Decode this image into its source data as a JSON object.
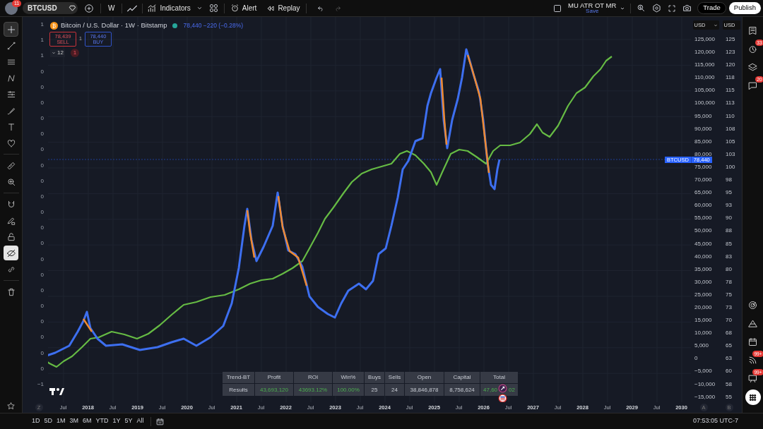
{
  "top_bar": {
    "avatar_badge": "11",
    "symbol": "BTCUSD",
    "interval": "W",
    "indicators": "Indicators",
    "alert": "Alert",
    "replay": "Replay",
    "history": [
      {
        "kind": "undo",
        "disabled": false
      },
      {
        "kind": "redo",
        "disabled": true
      }
    ],
    "layout_name": "MU ATR OT MR",
    "save_label": "Save",
    "trade": "Trade",
    "publish": "Publish"
  },
  "left_tool_groups": [
    {
      "tools": [
        {
          "kind": "crosshair",
          "selected": true,
          "on": false
        },
        {
          "kind": "line",
          "selected": false,
          "on": false
        },
        {
          "kind": "channel",
          "selected": false,
          "on": false
        },
        {
          "kind": "pattern",
          "selected": false,
          "on": false
        },
        {
          "kind": "fib",
          "selected": false,
          "on": false
        },
        {
          "kind": "brush",
          "selected": false,
          "on": false
        },
        {
          "kind": "text",
          "selected": false,
          "on": false
        },
        {
          "kind": "heart",
          "selected": false,
          "on": false
        }
      ]
    },
    {
      "tools": [
        {
          "kind": "ruler",
          "selected": false,
          "on": false
        },
        {
          "kind": "zoom",
          "selected": false,
          "on": false
        }
      ]
    },
    {
      "tools": [
        {
          "kind": "magnet",
          "selected": false,
          "on": false
        },
        {
          "kind": "pencil",
          "selected": false,
          "on": false
        },
        {
          "kind": "lock",
          "selected": false,
          "on": false
        },
        {
          "kind": "hide",
          "selected": false,
          "on": true
        },
        {
          "kind": "link",
          "selected": false,
          "on": false
        }
      ]
    },
    {
      "tools": [
        {
          "kind": "trash",
          "selected": false,
          "on": false
        }
      ]
    }
  ],
  "legend": {
    "coin_glyph": "₿",
    "title": "Bitcoin / U.S. Dollar · 1W · Bitstamp",
    "quote": "78,440 −220 (−0.28%)",
    "sell": {
      "price": "78,439",
      "label": "SELL"
    },
    "quantity": "1",
    "buy": {
      "price": "78,440",
      "label": "BUY"
    },
    "collapsed_count": "12",
    "alert_count": "1"
  },
  "left_axis": [
    "1",
    "1",
    "1",
    "0",
    "0",
    "0",
    "0",
    "0",
    "0",
    "0",
    "0",
    "0",
    "0",
    "0",
    "0",
    "0",
    "0",
    "0",
    "0",
    "0",
    "0",
    "0",
    "0",
    "−1"
  ],
  "price_axis": {
    "currency": "USD",
    "labels": [
      "125,000",
      "120,000",
      "115,000",
      "110,000",
      "105,000",
      "100,000",
      "95,000",
      "90,000",
      "85,000",
      "80,000",
      "75,000",
      "70,000",
      "65,000",
      "60,000",
      "55,000",
      "50,000",
      "45,000",
      "40,000",
      "35,000",
      "30,000",
      "25,000",
      "20,000",
      "15,000",
      "10,000",
      "5,000",
      "0",
      "−5,000",
      "−10,000",
      "−15,000"
    ]
  },
  "second_axis": {
    "currency": "USD",
    "labels": [
      "125",
      "123",
      "120",
      "118",
      "115",
      "113",
      "110",
      "108",
      "105",
      "103",
      "100",
      "98",
      "95",
      "93",
      "90",
      "88",
      "85",
      "83",
      "80",
      "78",
      "75",
      "73",
      "70",
      "68",
      "65",
      "63",
      "60",
      "58",
      "55"
    ]
  },
  "price_tag": {
    "symbol": "BTCUSD",
    "price": "78,440"
  },
  "time_axis": {
    "start": "Z",
    "labels": [
      "Jul",
      "2018",
      "Jul",
      "2019",
      "Jul",
      "2020",
      "Jul",
      "2021",
      "Jul",
      "2022",
      "Jul",
      "2023",
      "Jul",
      "2024",
      "Jul",
      "2025",
      "Jul",
      "2026",
      "Jul",
      "2027",
      "Jul",
      "2028",
      "Jul",
      "2029",
      "Jul",
      "2030"
    ],
    "end": [
      "A",
      "B"
    ]
  },
  "results_table": {
    "columns": [
      "Trend-BT",
      "Profit",
      "ROI",
      "Win%",
      "Buys",
      "Sells",
      "Open",
      "Capital",
      "Total"
    ],
    "rows": [
      [
        {
          "text": "Results",
          "positive": false
        },
        {
          "text": "43,693,120",
          "positive": true
        },
        {
          "text": "43693.12%",
          "positive": true
        },
        {
          "text": "100.00%",
          "positive": true
        },
        {
          "text": "25",
          "positive": false
        },
        {
          "text": "24",
          "positive": false
        },
        {
          "text": "38,846,878",
          "positive": false
        },
        {
          "text": "8,758,624",
          "positive": false
        },
        {
          "text": "47,60",
          "text_after": "02",
          "positive": true
        }
      ]
    ]
  },
  "right_sidebar": {
    "top": [
      {
        "kind": "watchlist"
      },
      {
        "kind": "alerts",
        "badge": "33"
      },
      {
        "kind": "layers"
      },
      {
        "kind": "chats",
        "badge": "20"
      }
    ],
    "bottom": [
      {
        "kind": "target"
      },
      {
        "kind": "ideas"
      },
      {
        "kind": "calendar"
      },
      {
        "kind": "news",
        "badge": "99+"
      },
      {
        "kind": "messages",
        "badge": "99+"
      },
      {
        "kind": "apps"
      }
    ]
  },
  "timeframes": [
    "1D",
    "5D",
    "1M",
    "3M",
    "6M",
    "YTD",
    "1Y",
    "5Y",
    "All"
  ],
  "clock": "07:53:05 UTC-7"
}
